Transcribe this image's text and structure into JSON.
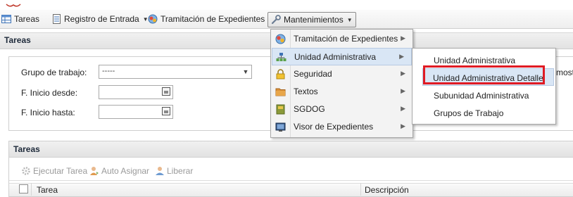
{
  "header": {
    "title_fragment": ""
  },
  "menubar": {
    "items": [
      {
        "label": "Tareas",
        "icon": "table-icon"
      },
      {
        "label": "Registro de Entrada",
        "icon": "document-icon"
      },
      {
        "label": "Tramitación de Expedientes",
        "icon": "globe-users-icon"
      },
      {
        "label": "Mantenimientos",
        "icon": "wrench-icon"
      }
    ]
  },
  "panel": {
    "title": "Tareas"
  },
  "form": {
    "grupo_label": "Grupo de trabajo:",
    "grupo_value": "-----",
    "inicio_desde_label": "F. Inicio desde:",
    "inicio_hasta_label": "F. Inicio hasta:",
    "mostrar_fragment": "most"
  },
  "grid": {
    "title": "Tareas",
    "toolbar": [
      "Ejecutar Tarea",
      "Auto Asignar",
      "Liberar"
    ],
    "columns": [
      "Tarea",
      "Descripción"
    ]
  },
  "mantenimientos_menu": {
    "items": [
      {
        "label": "Tramitación de Expedientes",
        "icon": "globe-users-icon",
        "has_submenu": true
      },
      {
        "label": "Unidad Administrativa",
        "icon": "org-chart-icon",
        "has_submenu": true,
        "highlighted": true
      },
      {
        "label": "Seguridad",
        "icon": "lock-icon",
        "has_submenu": true
      },
      {
        "label": "Textos",
        "icon": "folder-icon",
        "has_submenu": true
      },
      {
        "label": "SGDOG",
        "icon": "book-icon",
        "has_submenu": true
      },
      {
        "label": "Visor de Expedientes",
        "icon": "monitor-icon",
        "has_submenu": true
      }
    ]
  },
  "unidad_submenu": {
    "items": [
      {
        "label": "Unidad Administrativa"
      },
      {
        "label": "Unidad Administrativa Detalle",
        "highlighted": true
      },
      {
        "label": "Subunidad Administrativa"
      },
      {
        "label": "Grupos de Trabajo"
      }
    ]
  },
  "colors": {
    "highlight": "#d9e6f5",
    "annotation_red": "#e01b24",
    "header_bg": "#e6e6e6"
  }
}
